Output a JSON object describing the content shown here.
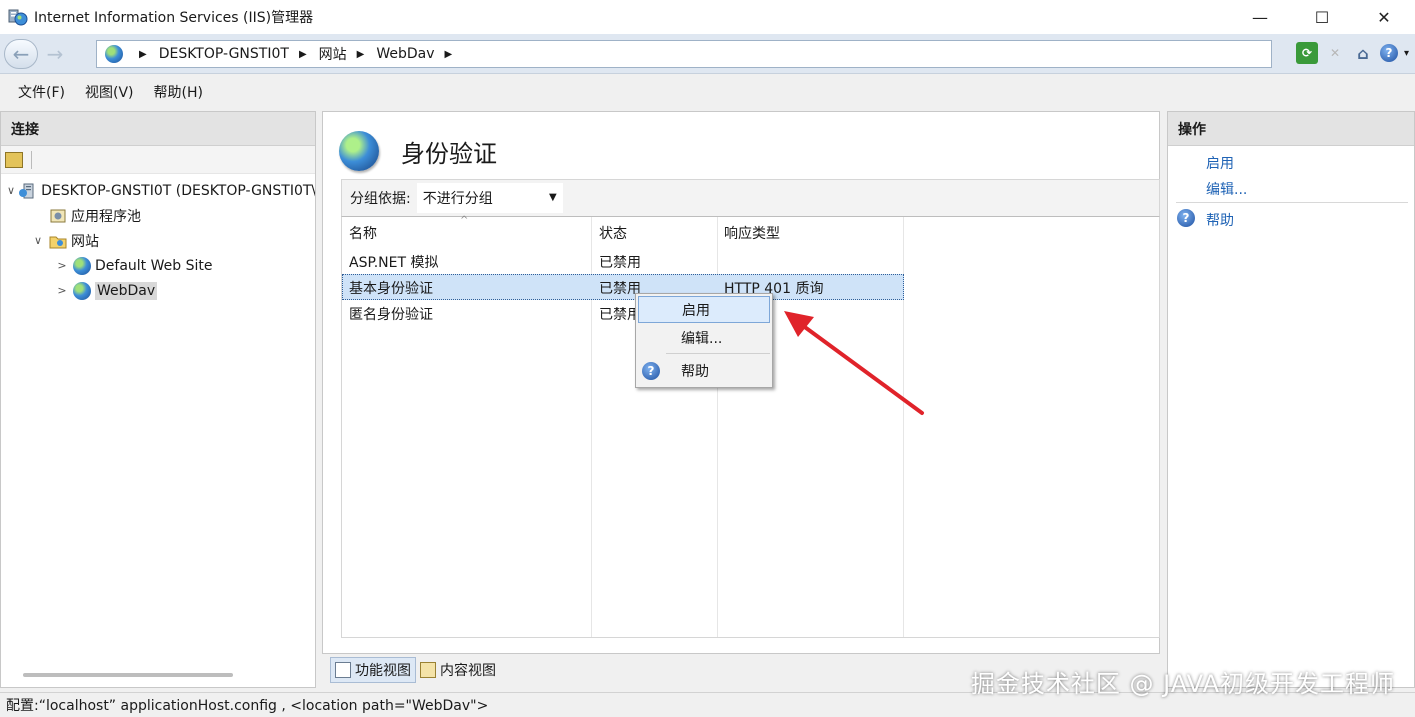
{
  "window": {
    "title": "Internet Information Services (IIS)管理器",
    "controls": {
      "minimize": "—",
      "maximize": "☐",
      "close": "✕"
    }
  },
  "address": {
    "crumbs": [
      "DESKTOP-GNSTI0T",
      "网站",
      "WebDav"
    ]
  },
  "menu": [
    "文件(F)",
    "视图(V)",
    "帮助(H)"
  ],
  "connections": {
    "header": "连接",
    "tree": [
      {
        "label": "DESKTOP-GNSTI0T (DESKTOP-GNSTI0T\\",
        "icon": "server-icon",
        "toggle": "∨"
      },
      {
        "label": "应用程序池",
        "icon": "app-pool-icon",
        "toggle": ""
      },
      {
        "label": "网站",
        "icon": "sites-folder-icon",
        "toggle": "∨"
      },
      {
        "label": "Default Web Site",
        "icon": "globe-icon",
        "toggle": ">"
      },
      {
        "label": "WebDav",
        "icon": "globe-icon",
        "toggle": ">"
      }
    ]
  },
  "feature": {
    "title": "身份验证",
    "group_label": "分组依据:",
    "group_value": "不进行分组",
    "columns": [
      "名称",
      "状态",
      "响应类型"
    ],
    "rows": [
      {
        "name": "ASP.NET 模拟",
        "status": "已禁用",
        "response": ""
      },
      {
        "name": "基本身份验证",
        "status": "已禁用",
        "response": "HTTP 401 质询"
      },
      {
        "name": "匿名身份验证",
        "status": "已禁用",
        "response": ""
      }
    ],
    "selected_row": 1
  },
  "context_menu": {
    "items": [
      "启用",
      "编辑...",
      "帮助"
    ]
  },
  "view_tabs": [
    "功能视图",
    "内容视图"
  ],
  "actions": {
    "header": "操作",
    "items": [
      "启用",
      "编辑...",
      "帮助"
    ]
  },
  "status": "配置:“localhost” applicationHost.config , <location path=\"WebDav\">",
  "watermark": "掘金技术社区 @ JAVA初级开发工程师",
  "colors": {
    "link": "#1f63b5",
    "selection": "#cfe3f8",
    "arrow": "#e0232a"
  }
}
